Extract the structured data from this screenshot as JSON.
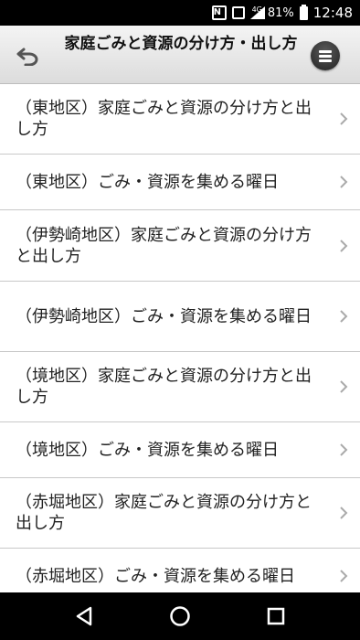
{
  "status_bar": {
    "nfc": "N",
    "network": "4G",
    "battery": "81%",
    "time": "12:48"
  },
  "header": {
    "title": "家庭ごみと資源の分け方・出し方",
    "back_icon": "undo-arrow-icon",
    "menu_icon": "menu-icon"
  },
  "items": [
    {
      "label": "（東地区）家庭ごみと資源の分け方と出し方"
    },
    {
      "label": "（東地区）ごみ・資源を集める曜日"
    },
    {
      "label": "（伊勢崎地区）家庭ごみと資源の分け方と出し方"
    },
    {
      "label": "（伊勢崎地区）ごみ・資源を集める曜日"
    },
    {
      "label": "（境地区）家庭ごみと資源の分け方と出し方"
    },
    {
      "label": "（境地区）ごみ・資源を集める曜日"
    },
    {
      "label": "（赤堀地区）家庭ごみと資源の分け方と出し方"
    },
    {
      "label": "（赤堀地区）ごみ・資源を集める曜日"
    }
  ],
  "nav": {
    "back": "back-triangle-icon",
    "home": "home-circle-icon",
    "recents": "recents-square-icon"
  }
}
